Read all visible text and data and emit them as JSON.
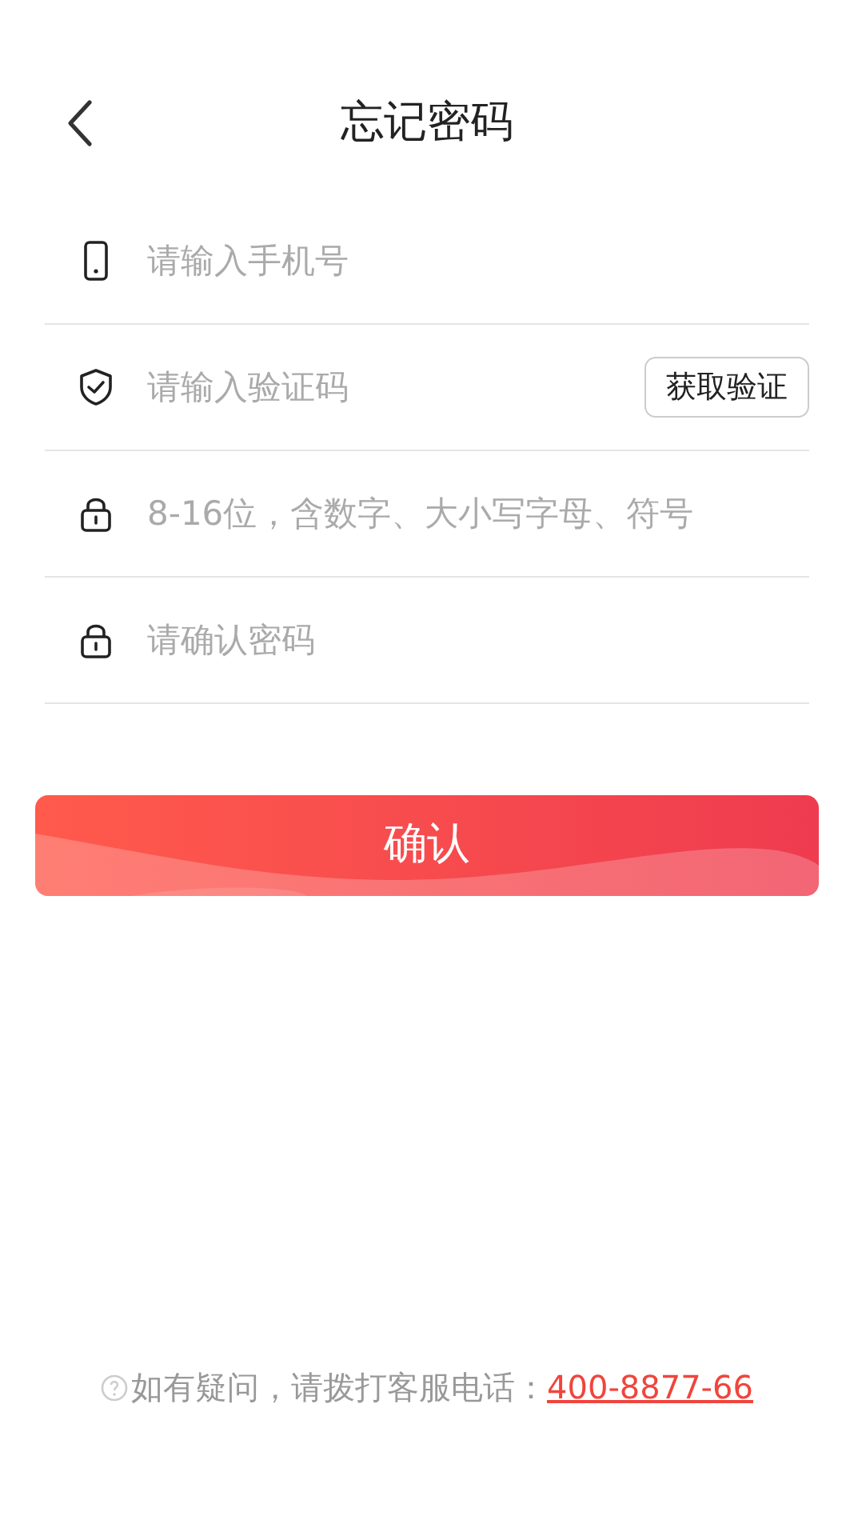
{
  "header": {
    "title": "忘记密码"
  },
  "fields": [
    {
      "kind": "phone",
      "placeholder": "请输入手机号"
    },
    {
      "kind": "shield",
      "placeholder": "请输入验证码",
      "action": "获取验证"
    },
    {
      "kind": "lock",
      "placeholder": "8-16位，含数字、大小写字母、符号"
    },
    {
      "kind": "lock",
      "placeholder": "请确认密码"
    }
  ],
  "confirm_button": "确认",
  "footer": {
    "text": "如有疑问，请拨打客服电话：",
    "phone": "400-8877-66"
  }
}
